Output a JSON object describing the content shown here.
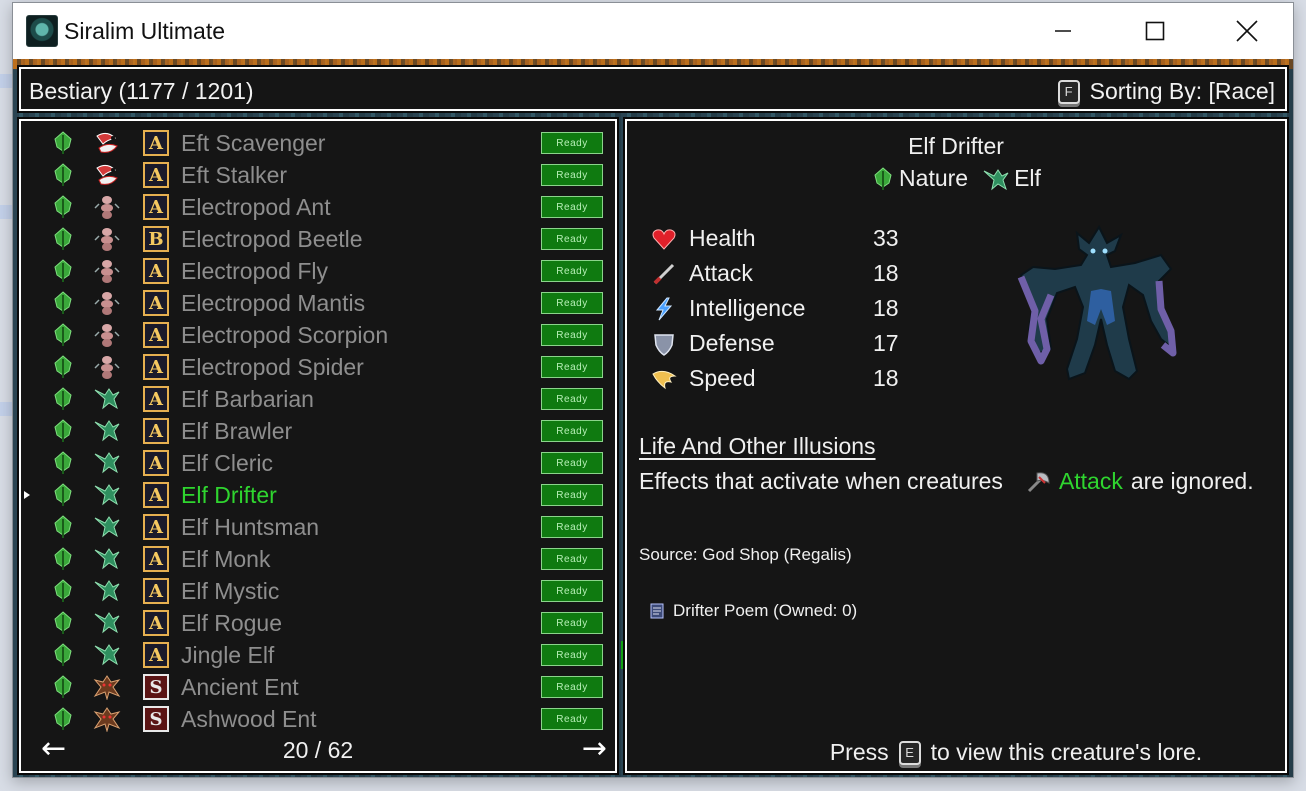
{
  "window": {
    "title": "Siralim Ultimate",
    "controls": [
      "minimize",
      "maximize",
      "close"
    ]
  },
  "header": {
    "title": "Bestiary (1177 / 1201)",
    "sort_key": "F",
    "sort_label": "Sorting By: [Race]"
  },
  "list": {
    "rows": [
      {
        "name": "Eft Scavenger",
        "tier": "A",
        "race": "eft",
        "status": "Ready"
      },
      {
        "name": "Eft Stalker",
        "tier": "A",
        "race": "eft",
        "status": "Ready"
      },
      {
        "name": "Electropod Ant",
        "tier": "A",
        "race": "electropod",
        "status": "Ready"
      },
      {
        "name": "Electropod Beetle",
        "tier": "B",
        "race": "electropod",
        "status": "Ready"
      },
      {
        "name": "Electropod Fly",
        "tier": "A",
        "race": "electropod",
        "status": "Ready"
      },
      {
        "name": "Electropod Mantis",
        "tier": "A",
        "race": "electropod",
        "status": "Ready"
      },
      {
        "name": "Electropod Scorpion",
        "tier": "A",
        "race": "electropod",
        "status": "Ready"
      },
      {
        "name": "Electropod Spider",
        "tier": "A",
        "race": "electropod",
        "status": "Ready"
      },
      {
        "name": "Elf Barbarian",
        "tier": "A",
        "race": "elf",
        "status": "Ready"
      },
      {
        "name": "Elf Brawler",
        "tier": "A",
        "race": "elf",
        "status": "Ready"
      },
      {
        "name": "Elf Cleric",
        "tier": "A",
        "race": "elf",
        "status": "Ready"
      },
      {
        "name": "Elf Drifter",
        "tier": "A",
        "race": "elf",
        "status": "Ready",
        "selected": true
      },
      {
        "name": "Elf Huntsman",
        "tier": "A",
        "race": "elf",
        "status": "Ready"
      },
      {
        "name": "Elf Monk",
        "tier": "A",
        "race": "elf",
        "status": "Ready"
      },
      {
        "name": "Elf Mystic",
        "tier": "A",
        "race": "elf",
        "status": "Ready"
      },
      {
        "name": "Elf Rogue",
        "tier": "A",
        "race": "elf",
        "status": "Ready"
      },
      {
        "name": "Jingle Elf",
        "tier": "A",
        "race": "elf",
        "status": "Ready"
      },
      {
        "name": "Ancient Ent",
        "tier": "S",
        "race": "ent",
        "status": "Ready"
      },
      {
        "name": "Ashwood Ent",
        "tier": "S",
        "race": "ent",
        "status": "Ready"
      }
    ],
    "page": "20 / 62",
    "prev_arrow": "←",
    "next_arrow": "→"
  },
  "detail": {
    "name": "Elf Drifter",
    "class_label": "Nature",
    "race_label": "Elf",
    "stats": [
      {
        "label": "Health",
        "value": "33",
        "icon": "heart-icon"
      },
      {
        "label": "Attack",
        "value": "18",
        "icon": "sword-icon"
      },
      {
        "label": "Intelligence",
        "value": "18",
        "icon": "lightning-icon"
      },
      {
        "label": "Defense",
        "value": "17",
        "icon": "shield-icon"
      },
      {
        "label": "Speed",
        "value": "18",
        "icon": "wing-icon"
      }
    ],
    "trait_name": "Life And Other Illusions",
    "trait_pre": "Effects that activate when creatures",
    "trait_keyword": "Attack",
    "trait_post": "are ignored.",
    "source": "Source: God Shop (Regalis)",
    "material": "Drifter Poem (Owned: 0)",
    "lore_press": "Press",
    "lore_key": "E",
    "lore_rest": "to view this creature's lore."
  },
  "colors": {
    "selected_text": "#2fd52f",
    "keyword": "#2fd52f",
    "ready_badge": "#0f7a10",
    "panel_bg": "#151515"
  }
}
